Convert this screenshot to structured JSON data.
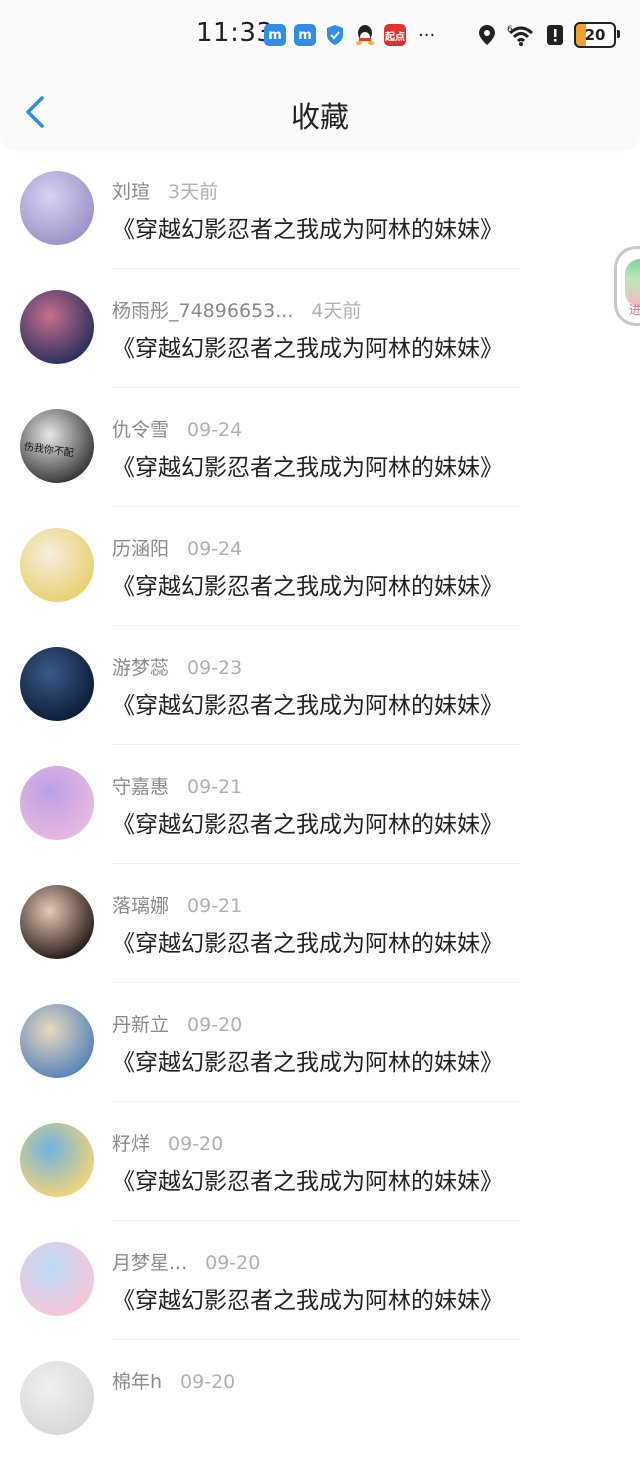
{
  "status_bar": {
    "time": "11:33",
    "app_icons": [
      {
        "name": "app-m-icon",
        "glyph": "m",
        "color": "#2f8de4"
      },
      {
        "name": "app-m-icon-2",
        "glyph": "m",
        "color": "#2f8de4"
      },
      {
        "name": "shield-app-icon",
        "glyph": "",
        "color": "#2f8de4"
      },
      {
        "name": "qq-icon",
        "glyph": "",
        "color": "#222222"
      },
      {
        "name": "qidian-icon",
        "glyph": "起点",
        "color": "#e0322f"
      }
    ],
    "more": "···",
    "battery": "20"
  },
  "header": {
    "title": "收藏",
    "back_icon": "chevron-left-icon",
    "accent": "#2d8ce6"
  },
  "items": [
    {
      "user": "刘瑄",
      "time": "3天前",
      "content": "《穿越幻影忍者之我成为阿林的妹妹》",
      "avatar_colors": [
        "#9d92c9",
        "#d9d3ef"
      ]
    },
    {
      "user": "杨雨彤_74896653...",
      "time": "4天前",
      "content": "《穿越幻影忍者之我成为阿林的妹妹》",
      "avatar_colors": [
        "#2a3160",
        "#c86f8a"
      ]
    },
    {
      "user": "仇令雪",
      "time": "09-24",
      "content": "《穿越幻影忍者之我成为阿林的妹妹》",
      "avatar_colors": [
        "#3a3a3a",
        "#e8e8e8"
      ],
      "avatar_text": "伤我你不配"
    },
    {
      "user": "历涵阳",
      "time": "09-24",
      "content": "《穿越幻影忍者之我成为阿林的妹妹》",
      "avatar_colors": [
        "#e8d070",
        "#f5efe0"
      ]
    },
    {
      "user": "游梦蕊",
      "time": "09-23",
      "content": "《穿越幻影忍者之我成为阿林的妹妹》",
      "avatar_colors": [
        "#0e1d3a",
        "#3a5a88"
      ]
    },
    {
      "user": "守嘉惠",
      "time": "09-21",
      "content": "《穿越幻影忍者之我成为阿林的妹妹》",
      "avatar_colors": [
        "#e9b7e0",
        "#b9a1e6"
      ]
    },
    {
      "user": "落璃娜",
      "time": "09-21",
      "content": "《穿越幻影忍者之我成为阿林的妹妹》",
      "avatar_colors": [
        "#2a1f1c",
        "#e6c9b8"
      ]
    },
    {
      "user": "丹新立",
      "time": "09-20",
      "content": "《穿越幻影忍者之我成为阿林的妹妹》",
      "avatar_colors": [
        "#5a86b8",
        "#e8d9c0"
      ]
    },
    {
      "user": "籽烊",
      "time": "09-20",
      "content": "《穿越幻影忍者之我成为阿林的妹妹》",
      "avatar_colors": [
        "#f1d37a",
        "#6fb3e0"
      ]
    },
    {
      "user": "月梦星...",
      "time": "09-20",
      "content": "《穿越幻影忍者之我成为阿林的妹妹》",
      "avatar_colors": [
        "#f6c6d8",
        "#b9dcf5"
      ]
    },
    {
      "user": "棉年h",
      "time": "09-20",
      "content": "",
      "avatar_colors": [
        "#d8d8d8",
        "#f0f0f0"
      ]
    }
  ],
  "float_widget": {
    "label": "进",
    "icon": "floating-promo-icon"
  }
}
